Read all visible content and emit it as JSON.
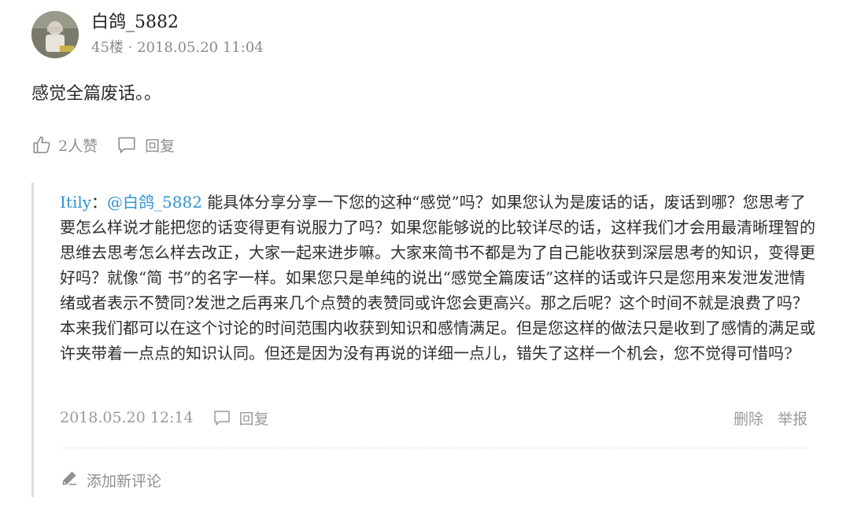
{
  "comment": {
    "username": "白鸽_5882",
    "floor_time": "45楼 · 2018.05.20 11:04",
    "content": "感觉全篇废话。。",
    "like_label": "2人赞",
    "reply_label": "回复",
    "avatar_label": "avatar"
  },
  "sub_comment": {
    "author": "Itily",
    "colon": "：",
    "mention": "@白鸽_5882",
    "text": " 能具体分享分享一下您的这种“感觉”吗？如果您认为是废话的话，废话到哪？您思考了要怎么样说才能把您的话变得更有说服力了吗？如果您能够说的比较详尽的话，这样我们才会用最清晰理智的思维去思考怎么样去改正，大家一起来进步嘛。大家来简书不都是为了自己能收获到深层思考的知识，变得更好吗？就像“简 书”的名字一样。如果您只是单纯的说出“感觉全篇废话”这样的话或许只是您用来发泄发泄情绪或者表示不赞同?发泄之后再来几个点赞的表赞同或许您会更高兴。那之后呢？这个时间不就是浪费了吗？本来我们都可以在这个讨论的时间范围内收获到知识和感情满足。但是您这样的做法只是收到了感情的满足或许夹带着一点点的知识认同。但还是因为没有再说的详细一点儿，错失了这样一个机会，您不觉得可惜吗?",
    "time": "2018.05.20 12:14",
    "reply_label": "回复",
    "delete_label": "删除",
    "report_label": "举报"
  },
  "add_comment_label": "添加新评论",
  "colors": {
    "link": "#3194d0",
    "muted": "#8f8f8f",
    "text": "#2e2e2e",
    "thread_border": "#dcdcdc"
  },
  "icons": [
    "thumbs-up-icon",
    "comment-bubble-icon",
    "pencil-icon"
  ]
}
